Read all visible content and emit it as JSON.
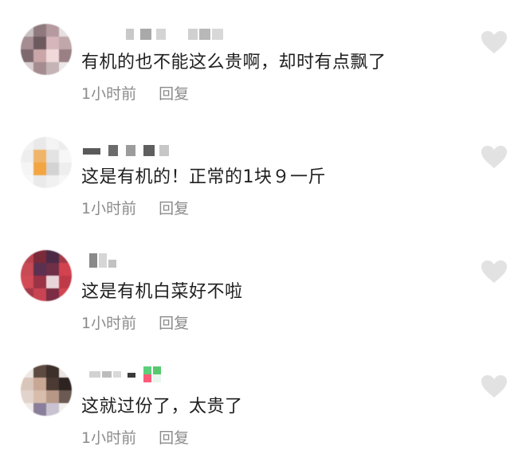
{
  "colors": {
    "text": "#202020",
    "meta": "#8b8b8b",
    "heart": "#e2e2e2"
  },
  "comments": [
    {
      "text": "有机的也不能这么贵啊，却时有点飘了",
      "time": "1小时前",
      "reply_label": "回复",
      "like_icon": "heart-icon"
    },
    {
      "text": "这是有机的！正常的1块９一斤",
      "time": "1小时前",
      "reply_label": "回复",
      "like_icon": "heart-icon"
    },
    {
      "text": "这是有机白菜好不啦",
      "time": "1小时前",
      "reply_label": "回复",
      "like_icon": "heart-icon"
    },
    {
      "text": "这就过份了，太贵了",
      "time": "1小时前",
      "reply_label": "回复",
      "like_icon": "heart-icon"
    }
  ]
}
